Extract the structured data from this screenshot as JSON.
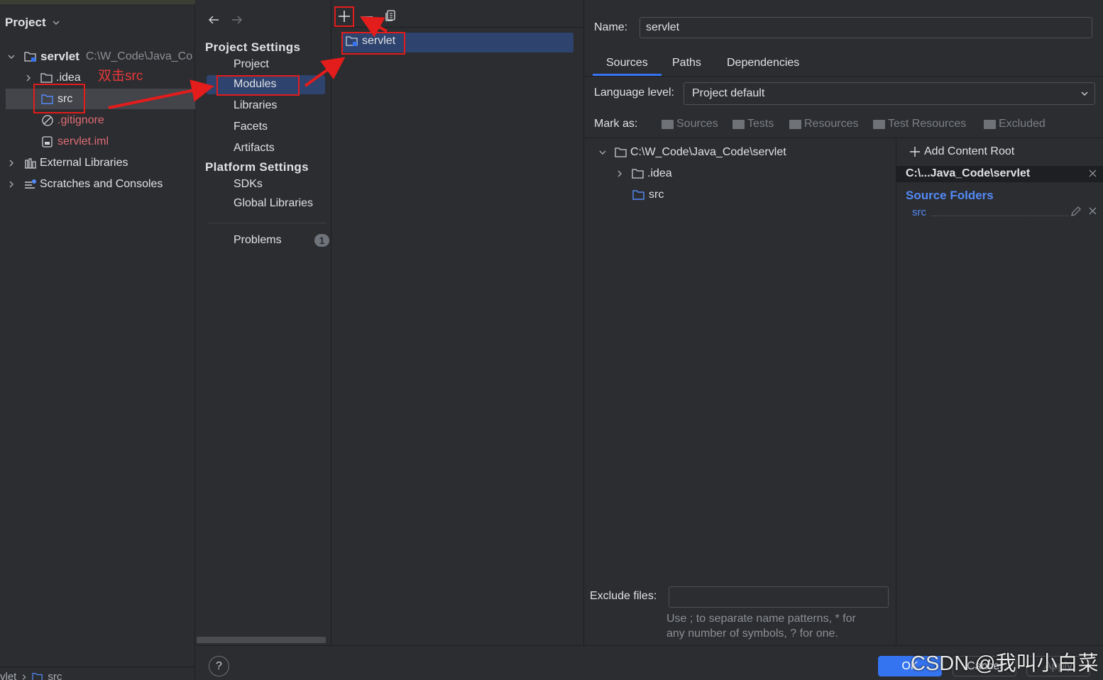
{
  "project_panel": {
    "title": "Project",
    "root": {
      "name": "servlet",
      "path": "C:\\W_Code\\Java_Co"
    },
    "items": [
      {
        "label": ".idea"
      },
      {
        "label": "src"
      },
      {
        "label": ".gitignore"
      },
      {
        "label": "servlet.iml"
      },
      {
        "label": "External Libraries"
      },
      {
        "label": "Scratches and Consoles"
      }
    ],
    "breadcrumb": {
      "part1": "vlet",
      "part2": "src"
    }
  },
  "annotation": {
    "double_click_text": "双击src"
  },
  "nav": {
    "project_settings_header": "Project Settings",
    "project_settings": [
      "Project",
      "Modules",
      "Libraries",
      "Facets",
      "Artifacts"
    ],
    "platform_settings_header": "Platform Settings",
    "platform_settings": [
      "SDKs",
      "Global Libraries"
    ],
    "problems_label": "Problems",
    "problems_count": "1"
  },
  "modules": {
    "items": [
      {
        "label": "servlet"
      }
    ]
  },
  "module_editor": {
    "name_label": "Name:",
    "name_value": "servlet",
    "tabs": [
      "Sources",
      "Paths",
      "Dependencies"
    ],
    "language_level_label": "Language level:",
    "language_level_value": "Project default",
    "mark_as_label": "Mark as:",
    "mark_as_options": [
      "Sources",
      "Tests",
      "Resources",
      "Test Resources",
      "Excluded"
    ],
    "tree": {
      "root": "C:\\W_Code\\Java_Code\\servlet",
      "children": [
        ".idea",
        "src"
      ]
    },
    "content_root": {
      "add_label": "Add Content Root",
      "path": "C:\\...Java_Code\\servlet",
      "source_folders_label": "Source Folders",
      "source_folder": "src"
    },
    "exclude_files_label": "Exclude files:",
    "exclude_files_value": "",
    "exclude_hint_line1": "Use ; to separate name patterns, * for",
    "exclude_hint_line2": "any number of symbols, ? for one."
  },
  "buttons": {
    "ok": "OK",
    "cancel": "Cancel",
    "apply": "Apply"
  },
  "watermark": "CSDN @我叫小白菜",
  "colors": {
    "selection": "#2e436e",
    "accent": "#3574f0",
    "link": "#548af7",
    "annotation_red": "#e31c1c"
  }
}
